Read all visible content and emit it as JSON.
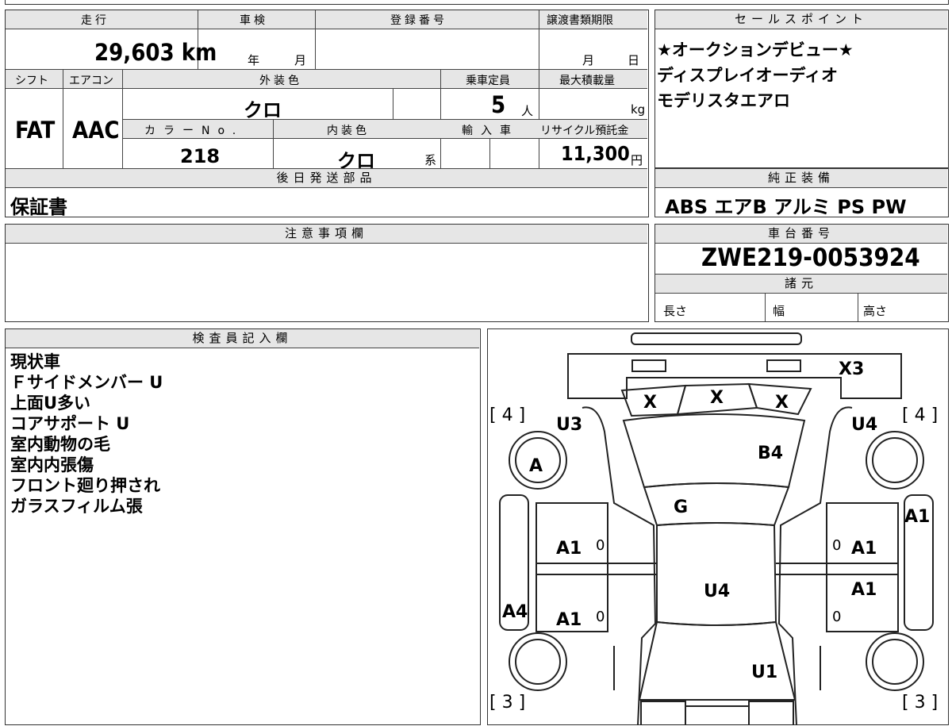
{
  "top_strip": {
    "partial_text": "車 検"
  },
  "summary": {
    "headers": {
      "mileage": "走行",
      "inspection": "車検",
      "registration": "登録番号",
      "transfer_deadline": "譲渡書類期限"
    },
    "mileage": "29,603 km",
    "inspection_year": "年",
    "inspection_month": "月",
    "transfer_month": "月",
    "transfer_day": "日",
    "headers2": {
      "shift": "シフト",
      "aircon": "エアコン",
      "exterior": "外装色",
      "capacity": "乗車定員",
      "max_load": "最大積載量"
    },
    "shift": "FAT",
    "aircon": "AAC",
    "exterior_color": "クロ",
    "capacity": "5",
    "capacity_unit": "人",
    "load_unit": "kg",
    "headers3": {
      "color_no": "カラーNo.",
      "interior": "内装色",
      "import": "輸入車",
      "recycle": "リサイクル預託金"
    },
    "color_no": "218",
    "interior_color": "クロ",
    "interior_suffix": "系",
    "recycle_fee": "11,300",
    "recycle_unit": "円",
    "later_parts_header": "後日発送部品",
    "later_parts": "保証書"
  },
  "sales": {
    "header": "セールスポイント",
    "lines": [
      "★オークションデビュー★",
      "ディスプレイオーディオ",
      "モデリスタエアロ"
    ]
  },
  "equipment": {
    "header": "純正装備",
    "items": "ABS エアB アルミ PS PW"
  },
  "caution": {
    "header": "注意事項欄"
  },
  "chassis": {
    "header": "車台番号",
    "number": "ZWE219-0053924",
    "specs_header": "諸元",
    "length": "長さ",
    "width": "幅",
    "height": "高さ"
  },
  "inspector": {
    "header": "検査員記入欄",
    "notes": [
      "現状車",
      "Ｆサイドメンバー U",
      "上面U多い",
      "コアサポート U",
      "室内動物の毛",
      "室内内張傷",
      "フロント廻り押され",
      "ガラスフィルム張"
    ]
  },
  "diagram": {
    "labels": {
      "x3": "X3",
      "x_left": "X",
      "x_center": "X",
      "x_right": "X",
      "tire_fl": "[ 4 ]",
      "tire_fr": "[ 4 ]",
      "tire_rl": "[ 3 ]",
      "tire_rr": "[ 3 ]",
      "u3": "U3",
      "u4_right": "U4",
      "b4": "B4",
      "a_wheel": "A",
      "g": "G",
      "a1_left_front": "A1",
      "a1_left_rear": "A1",
      "a1_right_front": "A1",
      "a1_right_rear": "A1",
      "a1_edge": "A1",
      "a4": "A4",
      "u4_roof": "U4",
      "u1": "U1",
      "zero_lf": "0",
      "zero_lr": "0",
      "zero_rf": "0",
      "zero_rr": "0"
    }
  }
}
